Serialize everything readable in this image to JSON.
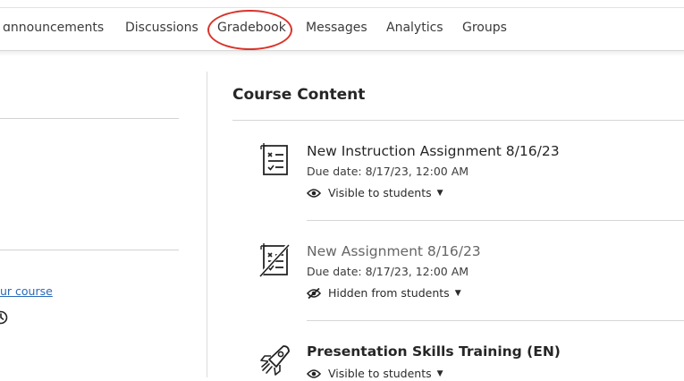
{
  "nav": {
    "tabs": [
      {
        "label": "ɑnnouncements"
      },
      {
        "label": "Discussions"
      },
      {
        "label": "Gradebook"
      },
      {
        "label": "Messages"
      },
      {
        "label": "Analytics"
      },
      {
        "label": "Groups"
      }
    ],
    "highlight_color": "#d9342b"
  },
  "left_panel": {
    "link_text": "ur course",
    "icon": "clock-icon"
  },
  "main": {
    "title": "Course Content",
    "items": [
      {
        "icon": "assignment-icon",
        "title": "New Instruction Assignment 8/16/23",
        "due": "Due date: 8/17/23, 12:00 AM",
        "visibility": "Visible to students",
        "visibility_icon": "eye-icon"
      },
      {
        "icon": "assignment-hidden-icon",
        "title": "New Assignment 8/16/23",
        "due": "Due date: 8/17/23, 12:00 AM",
        "visibility": "Hidden from students",
        "visibility_icon": "eye-slash-icon"
      },
      {
        "icon": "rocket-icon",
        "title": "Presentation Skills Training (EN)",
        "visibility": "Visible to students",
        "visibility_icon": "eye-icon"
      }
    ]
  }
}
